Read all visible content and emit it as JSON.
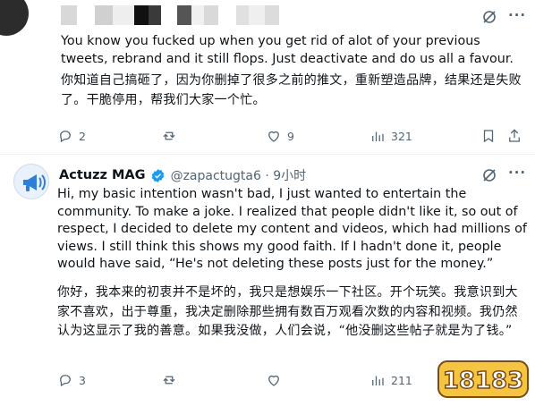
{
  "tweet1": {
    "text_en": "You know you fucked up when you get rid of alot of your previous tweets, rebrand and it still flops. Just deactivate and do us all a favour.",
    "text_zh": "你知道自己搞砸了，因为你删掉了很多之前的推文，重新塑造品牌，结果还是失败了。干脆停用，帮我们大家一个忙。",
    "replies": "2",
    "reposts": "",
    "likes": "9",
    "views": "321"
  },
  "tweet2": {
    "name": "Actuzz MAG",
    "handle": "@zapactugta6 · 9小时",
    "text_en": "Hi, my basic intention wasn't bad, I just wanted to entertain the community. To make a joke. I realized that people didn't like it, so out of respect, I decided to delete my content and videos, which had millions of views. I still think this shows my good faith. If I hadn't done it, people would have said, “He's not deleting these posts just for the money.”",
    "text_zh": "你好，我本来的初衷并不是坏的，我只是想娱乐一下社区。开个玩笑。我意识到大家不喜欢，出于尊重，我决定删除那些拥有数百万观看次数的内容和视频。我仍然认为这显示了我的善意。如果我没做，人们会说，“他没删这些帖子就是为了钱。”",
    "replies": "3",
    "reposts": "",
    "likes": "",
    "views": "211"
  },
  "watermark": {
    "text": "18183"
  },
  "colors": {
    "text": "#0f1419",
    "muted": "#536471",
    "verified": "#1d9bf0",
    "divider": "#eff3f4"
  }
}
